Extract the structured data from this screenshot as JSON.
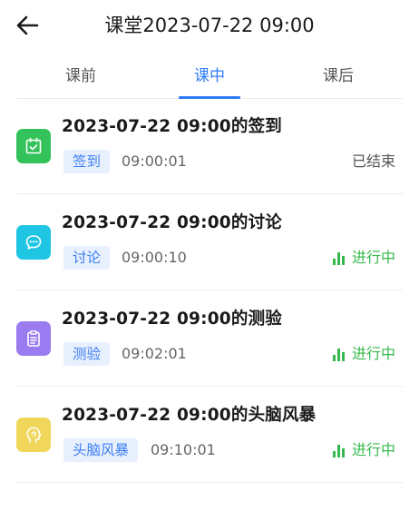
{
  "header": {
    "title": "课堂2023-07-22 09:00"
  },
  "tabs": [
    {
      "label": "课前",
      "active": false
    },
    {
      "label": "课中",
      "active": true
    },
    {
      "label": "课后",
      "active": false
    }
  ],
  "items": [
    {
      "title": "2023-07-22 09:00的签到",
      "tag": "签到",
      "time": "09:00:01",
      "status": "已结束",
      "status_type": "ended",
      "icon": "checkin-calendar-icon",
      "icon_color": "#34c35a"
    },
    {
      "title": "2023-07-22 09:00的讨论",
      "tag": "讨论",
      "time": "09:00:10",
      "status": "进行中",
      "status_type": "running",
      "icon": "discussion-chat-icon",
      "icon_color": "#1fc6e3"
    },
    {
      "title": "2023-07-22 09:00的测验",
      "tag": "测验",
      "time": "09:02:01",
      "status": "进行中",
      "status_type": "running",
      "icon": "quiz-clipboard-icon",
      "icon_color": "#9a7cf0"
    },
    {
      "title": "2023-07-22 09:00的头脑风暴",
      "tag": "头脑风暴",
      "time": "09:10:01",
      "status": "进行中",
      "status_type": "running",
      "icon": "brainstorm-head-icon",
      "icon_color": "#f0d75c"
    }
  ],
  "colors": {
    "accent": "#2f7cf6",
    "running": "#36b94c",
    "tag_bg": "#e8f0fd"
  }
}
